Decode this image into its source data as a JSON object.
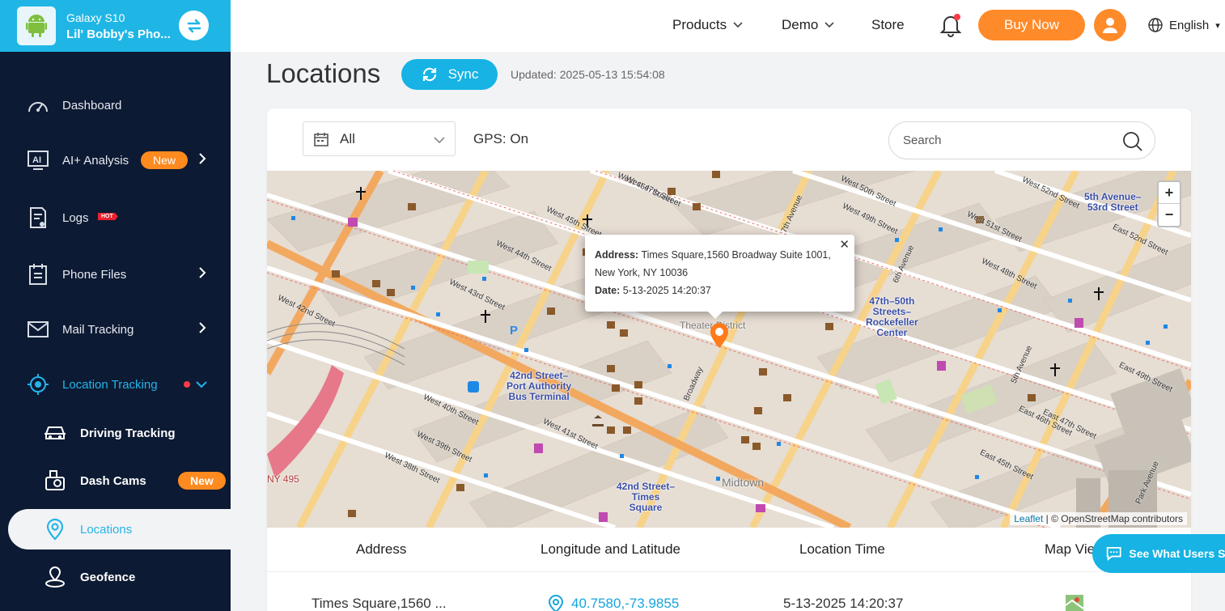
{
  "device": {
    "model": "Galaxy S10",
    "name": "Lil' Bobby's Pho..."
  },
  "sidebar": {
    "items": [
      {
        "label": "Dashboard"
      },
      {
        "label": "AI+ Analysis",
        "badge": "New"
      },
      {
        "label": "Logs",
        "badge": "HOT"
      },
      {
        "label": "Phone Files"
      },
      {
        "label": "Mail Tracking"
      },
      {
        "label": "Location Tracking"
      }
    ],
    "sub_items": [
      {
        "label": "Driving Tracking"
      },
      {
        "label": "Dash Cams",
        "badge": "New"
      },
      {
        "label": "Locations"
      },
      {
        "label": "Geofence"
      }
    ]
  },
  "topbar": {
    "products": "Products",
    "demo": "Demo",
    "store": "Store",
    "buy_now": "Buy Now",
    "language": "English"
  },
  "page": {
    "title": "Locations",
    "sync_label": "Sync",
    "updated": "Updated: 2025-05-13 15:54:08"
  },
  "filters": {
    "range": "All",
    "gps_status": "GPS: On",
    "search_placeholder": "Search"
  },
  "map": {
    "popup": {
      "address_label": "Address:",
      "address_line1": "Times Square,1560 Broadway Suite 1001,",
      "address_line2": "New York, NY 10036",
      "date_label": "Date:",
      "date_value": "5-13-2025 14:20:37"
    },
    "labels": {
      "theater": "Theater District",
      "port_authority": "42nd Street–\nPort Authority\nBus Terminal",
      "rockefeller": "47th–50th\nStreets–\nRockefeller\nCenter",
      "fifth_ave": "5th Avenue–\n53rd Street",
      "times_sq": "42nd Street–\nTimes\nSquare",
      "midtown": "Midtown",
      "ny495": "NY 495"
    },
    "streets": [
      "West 46th Street",
      "West 45th Street",
      "West 44th Street",
      "West 43rd Street",
      "West 42nd Street",
      "West 41st Street",
      "West 40th Street",
      "West 39th Street",
      "West 38th Street",
      "West 47th Street",
      "West 48th Street",
      "West 49th Street",
      "West 50th Street",
      "West 51st Street",
      "West 52nd Street",
      "East 45th Street",
      "East 46th Street",
      "East 47th Street",
      "East 49th Street",
      "East 52nd Street",
      "Broadway",
      "6th Avenue",
      "5th Avenue",
      "7th Avenue",
      "Park Avenue"
    ],
    "zoom_in": "+",
    "zoom_out": "−",
    "attribution_leaflet": "Leaflet",
    "attribution_osm": "| © OpenStreetMap contributors"
  },
  "table": {
    "headers": [
      "Address",
      "Longitude and Latitude",
      "Location Time",
      "Map View"
    ],
    "rows": [
      {
        "address": "Times Square,1560 ...",
        "coords": "40.7580,-73.9855",
        "time": "5-13-2025 14:20:37"
      }
    ]
  },
  "chat": {
    "label": "See What Users Say"
  },
  "colors": {
    "accent": "#16b3e4",
    "orange": "#ff8a2a",
    "sidebar": "#0d1a33"
  }
}
